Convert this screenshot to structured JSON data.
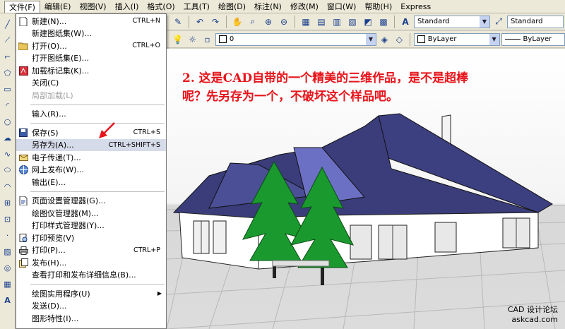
{
  "menubar": {
    "items": [
      "文件(F)",
      "编辑(E)",
      "视图(V)",
      "插入(I)",
      "格式(O)",
      "工具(T)",
      "绘图(D)",
      "标注(N)",
      "修改(M)",
      "窗口(W)",
      "帮助(H)",
      "Express"
    ]
  },
  "toolbar": {
    "text_style": "Standard",
    "dim_style": "Standard",
    "layer_value": "0",
    "color_value": "ByLayer",
    "linetype_value": "ByLayer"
  },
  "file_menu": {
    "items": [
      {
        "label": "新建(N)...",
        "shortcut": "CTRL+N",
        "icon": "new-icon",
        "disabled": false
      },
      {
        "label": "新建图纸集(W)...",
        "shortcut": "",
        "icon": "",
        "disabled": false
      },
      {
        "label": "打开(O)...",
        "shortcut": "CTRL+O",
        "icon": "open-icon",
        "disabled": false
      },
      {
        "label": "打开图纸集(E)...",
        "shortcut": "",
        "icon": "",
        "disabled": false
      },
      {
        "label": "加载标记集(K)...",
        "shortcut": "",
        "icon": "markup-icon",
        "disabled": false
      },
      {
        "label": "关闭(C)",
        "shortcut": "",
        "icon": "",
        "disabled": false
      },
      {
        "label": "局部加载(L)",
        "shortcut": "",
        "icon": "",
        "disabled": true
      },
      {
        "label": "输入(R)...",
        "shortcut": "",
        "icon": "",
        "disabled": false
      },
      {
        "label": "保存(S)",
        "shortcut": "CTRL+S",
        "icon": "save-icon",
        "disabled": false
      },
      {
        "label": "另存为(A)...",
        "shortcut": "CTRL+SHIFT+S",
        "icon": "",
        "disabled": false
      },
      {
        "label": "电子传递(T)...",
        "shortcut": "",
        "icon": "etransmit-icon",
        "disabled": false
      },
      {
        "label": "网上发布(W)...",
        "shortcut": "",
        "icon": "publish-web-icon",
        "disabled": false
      },
      {
        "label": "输出(E)...",
        "shortcut": "",
        "icon": "",
        "disabled": false
      },
      {
        "label": "页面设置管理器(G)...",
        "shortcut": "",
        "icon": "page-setup-icon",
        "disabled": false
      },
      {
        "label": "绘图仪管理器(M)...",
        "shortcut": "",
        "icon": "",
        "disabled": false
      },
      {
        "label": "打印样式管理器(Y)...",
        "shortcut": "",
        "icon": "",
        "disabled": false
      },
      {
        "label": "打印预览(V)",
        "shortcut": "",
        "icon": "print-preview-icon",
        "disabled": false
      },
      {
        "label": "打印(P)...",
        "shortcut": "CTRL+P",
        "icon": "print-icon",
        "disabled": false
      },
      {
        "label": "发布(H)...",
        "shortcut": "",
        "icon": "publish-icon",
        "disabled": false
      },
      {
        "label": "查看打印和发布详细信息(B)...",
        "shortcut": "",
        "icon": "",
        "disabled": false
      },
      {
        "label": "绘图实用程序(U)",
        "shortcut": "",
        "icon": "",
        "disabled": false
      },
      {
        "label": "发送(D)...",
        "shortcut": "",
        "icon": "",
        "disabled": false
      },
      {
        "label": "图形特性(I)...",
        "shortcut": "",
        "icon": "",
        "disabled": false
      }
    ]
  },
  "caption": "2. 这是CAD自带的一个精美的三维作品，是不是超棒呢？先另存为一个，不破坏这个样品吧。",
  "watermark": {
    "line1": "CAD 设计论坛",
    "line2": "askcad.com"
  },
  "colors": {
    "caption": "#e8141b",
    "roof": "#3a3f7c",
    "tree": "#1a9a2e",
    "menu_highlight": "#d6dbe9"
  }
}
